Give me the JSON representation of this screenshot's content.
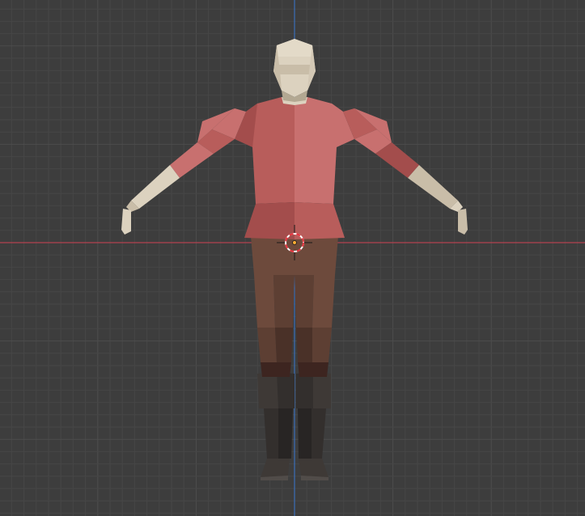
{
  "viewport": {
    "view": "front-orthographic",
    "grid_visible": true,
    "colors": {
      "background": "#3d3d3d",
      "grid_minor": "#464646",
      "grid_major": "#4d4d4d",
      "axis_x": "#b3424f",
      "axis_z": "#3b6fb8",
      "cursor_ring_red": "#e8323c",
      "cursor_ring_white": "#ffffff",
      "origin_dot": "#ffaa33"
    }
  },
  "model": {
    "object": "low-poly-character",
    "pose": "a-pose",
    "colors": {
      "skin_light": "#dcd2bf",
      "skin_mid": "#c9bda8",
      "skin_dark": "#b3a892",
      "shirt_light": "#c8706f",
      "shirt_mid": "#b85d5b",
      "shirt_dark": "#a34d4c",
      "pants_light": "#6d4a3c",
      "pants_mid": "#5d3f33",
      "pants_dark": "#4a3128",
      "pants_shadow": "#3d2520",
      "boots_light": "#3e3936",
      "boots_mid": "#332f2d",
      "boots_dark": "#282524",
      "soles": "#514c49"
    }
  }
}
